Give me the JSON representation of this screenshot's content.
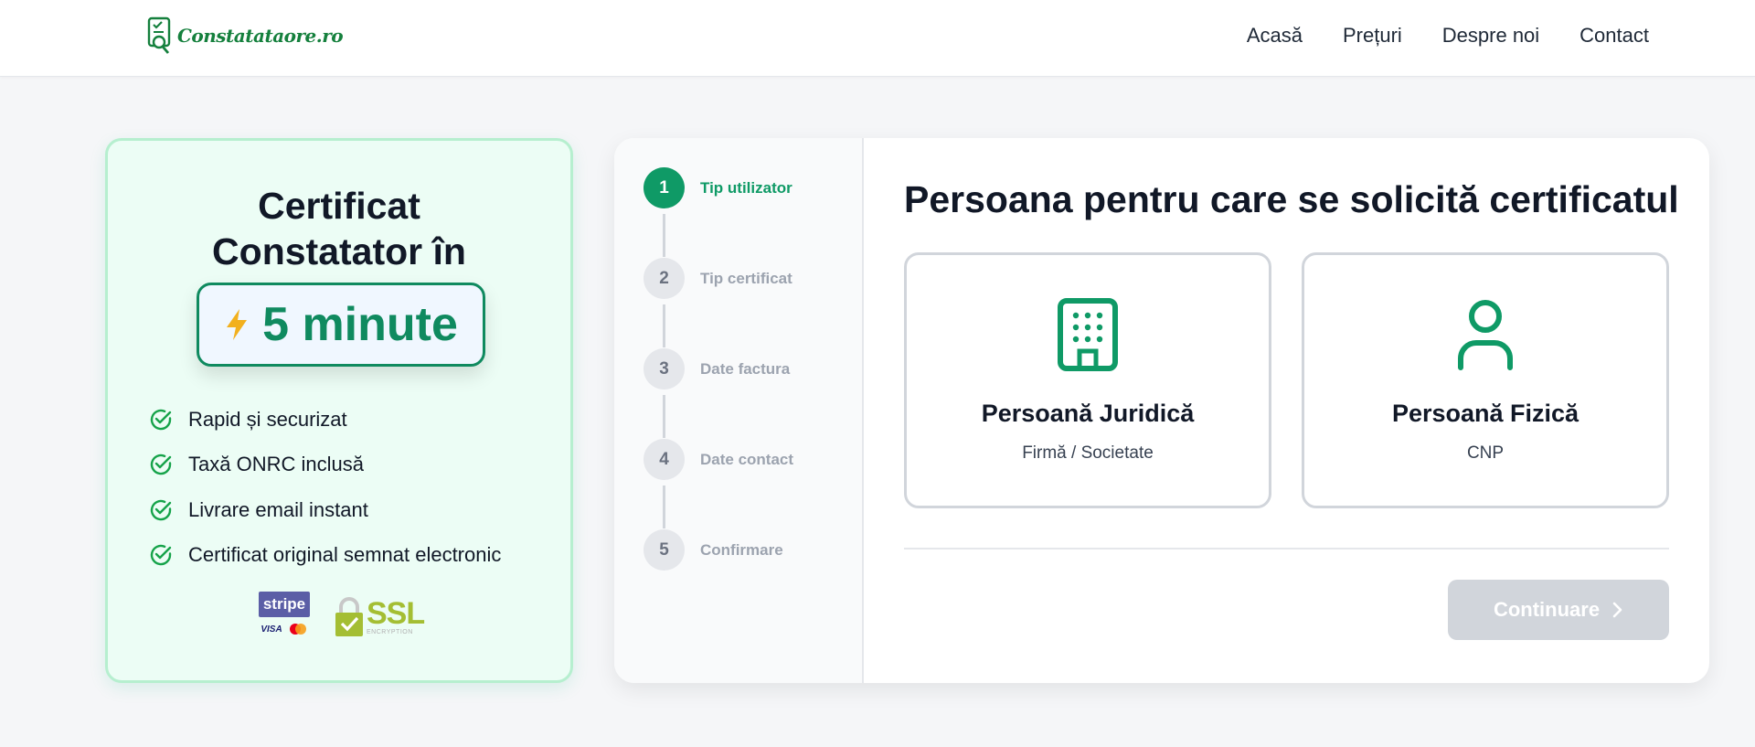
{
  "header": {
    "logo_text": "Constatataore.ro",
    "nav": [
      {
        "label": "Acasă",
        "icon": null
      },
      {
        "label": "Prețuri"
      },
      {
        "label": "Despre noi"
      },
      {
        "label": "Contact"
      }
    ]
  },
  "promo": {
    "title_line1": "Certificat",
    "title_line2": "Constatator în",
    "badge_icon": "lightning-icon",
    "badge_text": "5 minute",
    "features": [
      "Rapid și securizat",
      "Taxă ONRC inclusă",
      "Livrare email instant",
      "Certificat original semnat electronic"
    ],
    "stripe_label": "stripe",
    "visa_label": "VISA",
    "ssl_label": "SSL",
    "ssl_sub": "ENCRYPTION"
  },
  "stepper": {
    "steps": [
      {
        "number": "1",
        "label": "Tip utilizator",
        "active": true
      },
      {
        "number": "2",
        "label": "Tip certificat",
        "active": false
      },
      {
        "number": "3",
        "label": "Date factura",
        "active": false
      },
      {
        "number": "4",
        "label": "Date contact",
        "active": false
      },
      {
        "number": "5",
        "label": "Confirmare",
        "active": false
      }
    ]
  },
  "main": {
    "title": "Persoana pentru care se solicită certificatul",
    "options": [
      {
        "icon": "building-icon",
        "title": "Persoană Juridică",
        "subtitle": "Firmă / Societate"
      },
      {
        "icon": "person-icon",
        "title": "Persoană Fizică",
        "subtitle": "CNP"
      }
    ],
    "continue_label": "Continuare",
    "continue_icon": "chevron-right-icon"
  },
  "colors": {
    "accent": "#0f9a66",
    "promo_bg": "#ecfdf5",
    "disabled_button": "#d1d5db",
    "lightning": "#f2b01e"
  }
}
